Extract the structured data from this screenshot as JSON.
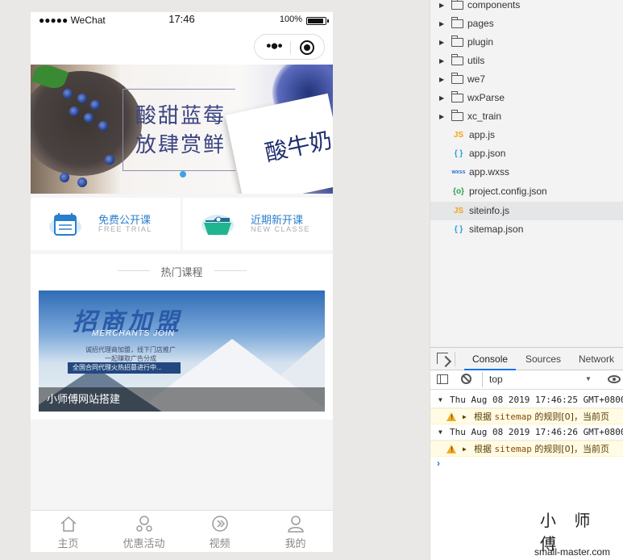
{
  "phone": {
    "status": {
      "carrier": "●●●●● WeChat",
      "time": "17:46",
      "battery": "100%"
    },
    "banner": {
      "slogan_line1": "酸甜蓝莓",
      "slogan_line2": "放肆赏鲜",
      "product": "酸牛奶"
    },
    "quick": [
      {
        "title": "免费公开课",
        "subtitle": "FREE TRIAL",
        "icon": "calendar-icon"
      },
      {
        "title": "近期新开课",
        "subtitle": "NEW CLASSE",
        "icon": "folder-icon"
      }
    ],
    "section_title": "热门课程",
    "course": {
      "headline": "招商加盟",
      "headline_en": "MERCHANTS JOIN",
      "desc": "诚招代理商加盟，线下门店推广 一起赚取广告分成",
      "strip": "全国合同代理火热招募进行中...",
      "caption": "小师傅网站搭建"
    },
    "tabs": [
      {
        "label": "主页",
        "icon": "home-icon"
      },
      {
        "label": "优惠活动",
        "icon": "discount-icon"
      },
      {
        "label": "视频",
        "icon": "video-icon"
      },
      {
        "label": "我的",
        "icon": "profile-icon"
      }
    ]
  },
  "tree": {
    "folders": [
      "components",
      "pages",
      "plugin",
      "utils",
      "we7",
      "wxParse",
      "xc_train"
    ],
    "files": [
      {
        "badge": "JS",
        "name": "app.js",
        "color": "#f2a51b"
      },
      {
        "badge": "{ }",
        "name": "app.json",
        "color": "#2a9fd6"
      },
      {
        "badge": "wxss",
        "name": "app.wxss",
        "color": "#2a6fd6"
      },
      {
        "badge": "{o}",
        "name": "project.config.json",
        "color": "#2fa050"
      },
      {
        "badge": "JS",
        "name": "siteinfo.js",
        "color": "#f2a51b",
        "active": true
      },
      {
        "badge": "{ }",
        "name": "sitemap.json",
        "color": "#2a9fd6"
      }
    ]
  },
  "console": {
    "tabs": [
      "Console",
      "Sources",
      "Network"
    ],
    "context": "top",
    "logs": [
      {
        "time": "Thu Aug 08 2019 17:46:25 GMT+0800",
        "warn_text": "根据",
        "warn_code": "sitemap",
        "warn_rest": "的规则[0]，当前页"
      },
      {
        "time": "Thu Aug 08 2019 17:46:26 GMT+0800",
        "warn_text": "根据",
        "warn_code": "sitemap",
        "warn_rest": "的规则[0]，当前页"
      }
    ],
    "prompt": "›"
  },
  "watermark": {
    "name": "小 师 傅",
    "site": "small-master.com"
  }
}
